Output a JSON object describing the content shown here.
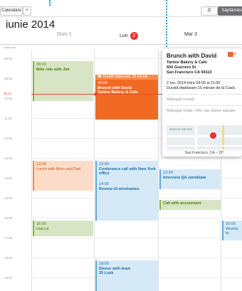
{
  "toolbar": {
    "calendars_label": "Calendare",
    "add_label": "+",
    "day_view_label": "Zi",
    "week_view_label": "Săptămână"
  },
  "header": {
    "month_title": "iunie 2014",
    "days": [
      {
        "name": "Dum",
        "number": "1",
        "is_today": false
      },
      {
        "name": "Lun",
        "number": "2",
        "is_today": true
      },
      {
        "name": "Mar",
        "number": "3",
        "is_today": false
      }
    ],
    "all_day_label": "toată ziua"
  },
  "time_labels": [
    "08:00",
    "09:00",
    "10:00",
    "11:00",
    "12:00",
    "13:00",
    "14:00",
    "15:00",
    "16:00",
    "17:00",
    "18:00",
    "19:00"
  ],
  "now_label": "09:41",
  "events": {
    "bike": {
      "time": "08:00",
      "title": "Bike ride with Jim"
    },
    "brunch": {
      "travel": "Durată deplasare: 15 minute",
      "time": "09:00",
      "title": "Brunch with David",
      "place": "Tartine Bakery & Cafe"
    },
    "lunch": {
      "time": "13:00",
      "title": "Lunch with Mom and Dad"
    },
    "conference": {
      "time": "13:00",
      "title": "Conference call with New York office"
    },
    "review": {
      "time": "14:00",
      "title": "Review UI wireframes"
    },
    "interview": {
      "time": "13:30",
      "title": "Interview QA candidate"
    },
    "accountant": {
      "title": "Call with accountant"
    },
    "haircut": {
      "time": "16:00",
      "title": "Haircut"
    },
    "weekly": {
      "time": "16:00",
      "title": "Weekly te"
    },
    "dinner": {
      "time": "18:00",
      "title": "Dinner with team",
      "place": "25 Lusk"
    }
  },
  "popover": {
    "title": "Brunch with David",
    "address": [
      "Tartine Bakery & Cafe",
      "600 Guerrero St",
      "San Francisco CA 94110"
    ],
    "date_line": "2 iun. 2014  între 09:00 și 11:00",
    "travel_line": "Durată deplasare:15 minute de la Casă",
    "invitees_label": "Adăugați invitați",
    "notes_label": "Adăugați notițe, URL sau fișiere atașate",
    "map_place": "Mission Dolores",
    "map_caption": "San Francisco, CA – 15°"
  },
  "colors": {
    "accent": "#1b9bd8",
    "today_badge": "#e6382f",
    "now_line": "#e94a2c",
    "event_orange": "#f06a23",
    "event_green": "#d7e5c4",
    "event_blue": "#d6e9f7",
    "event_salmon": "#fbdcc8"
  }
}
